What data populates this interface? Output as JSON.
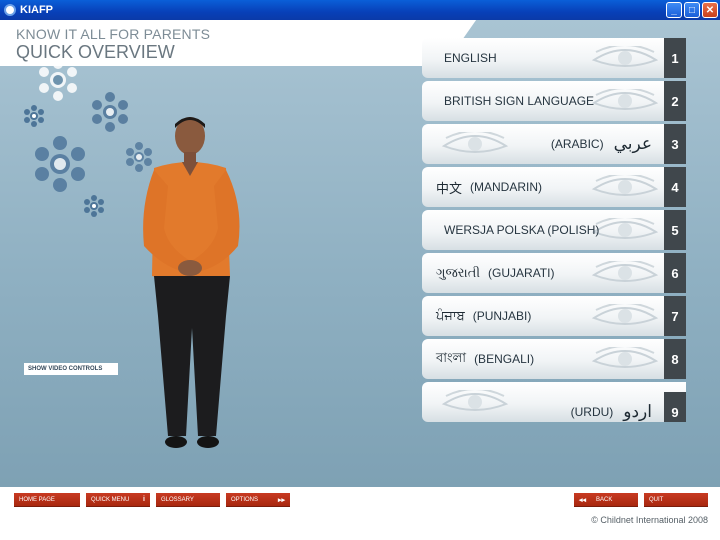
{
  "window": {
    "title": "KIAFP",
    "buttons": [
      "_",
      "□",
      "✕"
    ]
  },
  "header": {
    "subtitle": "KNOW IT ALL FOR PARENTS",
    "title": "QUICK OVERVIEW"
  },
  "video_controls_label": "SHOW VIDEO CONTROLS",
  "languages": [
    {
      "label": "ENGLISH",
      "native": "",
      "number": "1",
      "eye_side": "right"
    },
    {
      "label": "BRITISH SIGN LANGUAGE",
      "native": "",
      "number": "2",
      "eye_side": "right"
    },
    {
      "label": "(ARABIC)",
      "native": "عربي",
      "number": "3",
      "eye_side": "left"
    },
    {
      "label": "(MANDARIN)",
      "native": "中文",
      "number": "4",
      "eye_side": "right"
    },
    {
      "label": "WERSJA POLSKA  (POLISH)",
      "native": "",
      "number": "5",
      "eye_side": "right"
    },
    {
      "label": "(GUJARATI)",
      "native": "ગુજરાતી",
      "number": "6",
      "eye_side": "right"
    },
    {
      "label": "(PUNJABI)",
      "native": "ਪੰਜਾਬ",
      "number": "7",
      "eye_side": "right"
    },
    {
      "label": "(BENGALI)",
      "native": "বাংলা",
      "number": "8",
      "eye_side": "right"
    },
    {
      "label": "(URDU)",
      "native": "اردو",
      "number": "9",
      "eye_side": "left"
    }
  ],
  "toolbar": {
    "home": "HOME PAGE",
    "quick_menu": "QUICK MENU",
    "quick_menu_glyph": "i",
    "glossary": "GLOSSARY",
    "options": "OPTIONS",
    "options_glyph": "▸▸",
    "back": "BACK",
    "back_glyph": "◂◂",
    "quit": "QUIT"
  },
  "copyright": "© Childnet International 2008",
  "colors": {
    "stage_top": "#a9c4d3",
    "number_tab": "#40474c",
    "toolbar_button": "#b8301a",
    "title_text": "#6a7780"
  }
}
